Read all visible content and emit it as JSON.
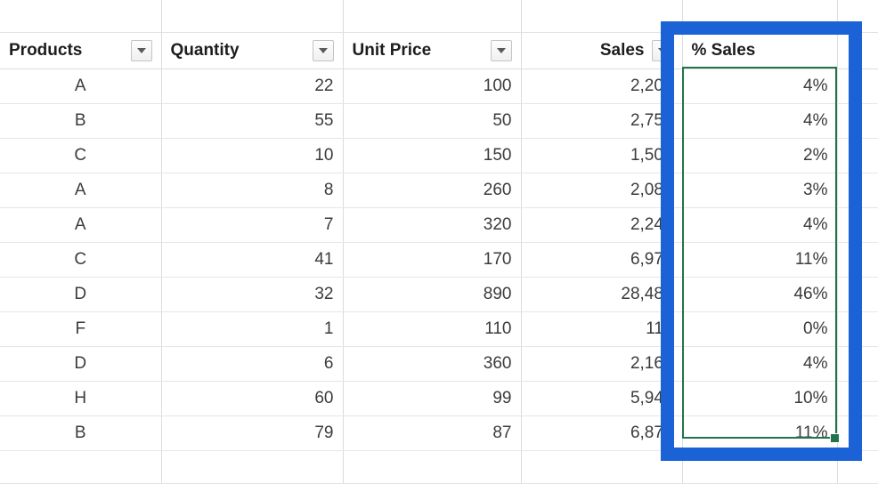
{
  "spreadsheet": {
    "columns": [
      {
        "key": "products",
        "label": "Products",
        "align": "center",
        "has_filter": true
      },
      {
        "key": "quantity",
        "label": "Quantity",
        "align": "right",
        "has_filter": true
      },
      {
        "key": "unit_price",
        "label": "Unit Price",
        "align": "right",
        "has_filter": true
      },
      {
        "key": "sales",
        "label": "Sales",
        "align": "right",
        "has_filter": true
      },
      {
        "key": "pct_sales",
        "label": "% Sales",
        "align": "right",
        "has_filter": false
      }
    ],
    "headers": {
      "products": "Products",
      "quantity": "Quantity",
      "unit_price": "Unit Price",
      "sales": "Sales",
      "pct_sales": "% Sales"
    },
    "rows": [
      {
        "products": "A",
        "quantity": "22",
        "unit_price": "100",
        "sales": "2,200",
        "pct_sales": "4%"
      },
      {
        "products": "B",
        "quantity": "55",
        "unit_price": "50",
        "sales": "2,750",
        "pct_sales": "4%"
      },
      {
        "products": "C",
        "quantity": "10",
        "unit_price": "150",
        "sales": "1,500",
        "pct_sales": "2%"
      },
      {
        "products": "A",
        "quantity": "8",
        "unit_price": "260",
        "sales": "2,080",
        "pct_sales": "3%"
      },
      {
        "products": "A",
        "quantity": "7",
        "unit_price": "320",
        "sales": "2,240",
        "pct_sales": "4%"
      },
      {
        "products": "C",
        "quantity": "41",
        "unit_price": "170",
        "sales": "6,970",
        "pct_sales": "11%"
      },
      {
        "products": "D",
        "quantity": "32",
        "unit_price": "890",
        "sales": "28,480",
        "pct_sales": "46%"
      },
      {
        "products": "F",
        "quantity": "1",
        "unit_price": "110",
        "sales": "110",
        "pct_sales": "0%"
      },
      {
        "products": "D",
        "quantity": "6",
        "unit_price": "360",
        "sales": "2,160",
        "pct_sales": "4%"
      },
      {
        "products": "H",
        "quantity": "60",
        "unit_price": "99",
        "sales": "5,940",
        "pct_sales": "10%"
      },
      {
        "products": "B",
        "quantity": "79",
        "unit_price": "87",
        "sales": "6,873",
        "pct_sales": "11%"
      }
    ],
    "selection": {
      "column": "% Sales",
      "active_row_index": 0,
      "outline_color": "#21734d",
      "shaded_fill": "#d4d4d4"
    },
    "annotation": {
      "shape": "rectangle",
      "color": "#1a62d6",
      "target_column": "% Sales"
    },
    "icons": {
      "filter": "filter-dropdown-icon"
    }
  }
}
